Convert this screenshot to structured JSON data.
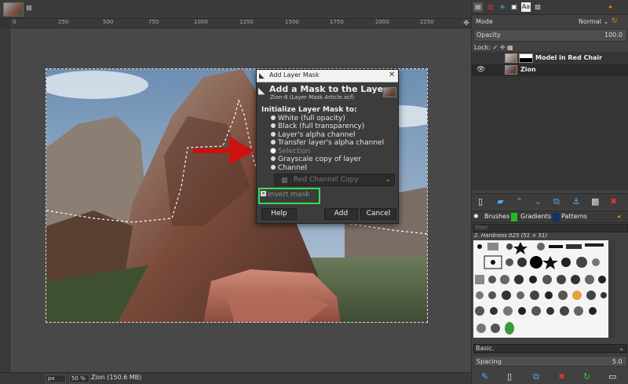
{
  "image_tab": {
    "close": "⊠"
  },
  "rulers": {
    "ticks": [
      "0",
      "250",
      "500",
      "750",
      "1000",
      "1250",
      "1500",
      "1750",
      "2000",
      "2250"
    ]
  },
  "statusbar": {
    "unit": "px",
    "zoom": "50 %",
    "title": "Zion (150.6 MB)"
  },
  "dialog": {
    "title": "Add Layer Mask",
    "heading": "Add a Mask to the Layer",
    "subtitle": "Zion-8 (Layer Mask Article.xcf)",
    "init_label": "Initialize Layer Mask to:",
    "options": [
      "White (full opacity)",
      "Black (full transparency)",
      "Layer's alpha channel",
      "Transfer layer's alpha channel",
      "Selection",
      "Grayscale copy of layer",
      "Channel"
    ],
    "selected_option": "Selection",
    "channel_value": "Red Channel Copy",
    "invert_label": "Invert mask",
    "invert_checked": true,
    "buttons": {
      "help": "Help",
      "add": "Add",
      "cancel": "Cancel"
    },
    "highlight_color": "#33dd55",
    "arrow_color": "#cc1111"
  },
  "layers_panel": {
    "mode_label": "Mode",
    "mode_value": "Normal ⌄",
    "opacity_label": "Opacity",
    "opacity_value": "100.0",
    "lock_label": "Lock:",
    "layers": [
      {
        "name": "Model in Red Chair",
        "visible": false
      },
      {
        "name": "Zion",
        "visible": true
      }
    ]
  },
  "brushes_panel": {
    "tabs": {
      "brushes": "Brushes",
      "gradients": "Gradients",
      "patterns": "Patterns"
    },
    "filter_placeholder": "filter",
    "current_brush": "2. Hardness 025 (51 × 51)",
    "preset": "Basic.",
    "spacing_label": "Spacing",
    "spacing_value": "5.0"
  }
}
